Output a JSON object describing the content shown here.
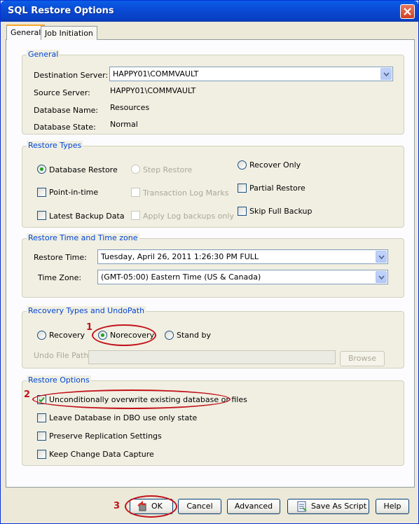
{
  "window": {
    "title": "SQL Restore Options"
  },
  "tabs": [
    {
      "label": "General",
      "active": true
    },
    {
      "label": "Job Initiation",
      "active": false
    }
  ],
  "general": {
    "title": "General",
    "destination_server_label": "Destination Server:",
    "destination_server_value": "HAPPY01\\COMMVAULT",
    "source_server_label": "Source Server:",
    "source_server_value": "HAPPY01\\COMMVAULT",
    "database_name_label": "Database Name:",
    "database_name_value": "Resources",
    "database_state_label": "Database State:",
    "database_state_value": "Normal"
  },
  "restore_types": {
    "title": "Restore Types",
    "database_restore": {
      "label": "Database Restore",
      "checked": true
    },
    "step_restore": {
      "label": "Step Restore",
      "checked": false,
      "disabled": true
    },
    "recover_only": {
      "label": "Recover Only",
      "checked": false
    },
    "point_in_time": {
      "label": "Point-in-time",
      "checked": false
    },
    "transaction_log_marks": {
      "label": "Transaction Log Marks",
      "checked": false,
      "disabled": true
    },
    "partial_restore": {
      "label": "Partial Restore",
      "checked": false
    },
    "latest_backup_data": {
      "label": "Latest Backup Data",
      "checked": false
    },
    "apply_log_backups_only": {
      "label": "Apply Log backups only",
      "checked": false,
      "disabled": true
    },
    "skip_full_backup": {
      "label": "Skip Full Backup",
      "checked": false
    }
  },
  "restore_time": {
    "title": "Restore Time and Time zone",
    "restore_time_label": "Restore Time:",
    "restore_time_value": "Tuesday, April 26, 2011 1:26:30 PM FULL",
    "time_zone_label": "Time Zone:",
    "time_zone_value": "(GMT-05:00) Eastern Time (US & Canada)"
  },
  "recovery_types": {
    "title": "Recovery Types and UndoPath",
    "recovery": {
      "label": "Recovery",
      "checked": false
    },
    "norecovery": {
      "label": "Norecovery",
      "checked": true
    },
    "stand_by": {
      "label": "Stand by",
      "checked": false
    },
    "undo_file_path_label": "Undo File Path:",
    "undo_file_path_value": "",
    "browse_label": "Browse"
  },
  "restore_options": {
    "title": "Restore Options",
    "unconditionally_overwrite": {
      "label": "Unconditionally overwrite existing database or files",
      "checked": true
    },
    "leave_dbo_only": {
      "label": "Leave Database in DBO use only state",
      "checked": false
    },
    "preserve_replication": {
      "label": "Preserve Replication Settings",
      "checked": false
    },
    "keep_change_data_capture": {
      "label": "Keep Change Data Capture",
      "checked": false
    }
  },
  "buttons": {
    "ok": "OK",
    "cancel": "Cancel",
    "advanced": "Advanced",
    "save_as_script": "Save As Script",
    "help": "Help"
  },
  "callouts": [
    "1",
    "2",
    "3"
  ],
  "colors": {
    "title_bar": "#0a4bd6",
    "group_title": "#0046d5",
    "callout_red": "#c2131b",
    "radio_checked": "#21a121"
  }
}
